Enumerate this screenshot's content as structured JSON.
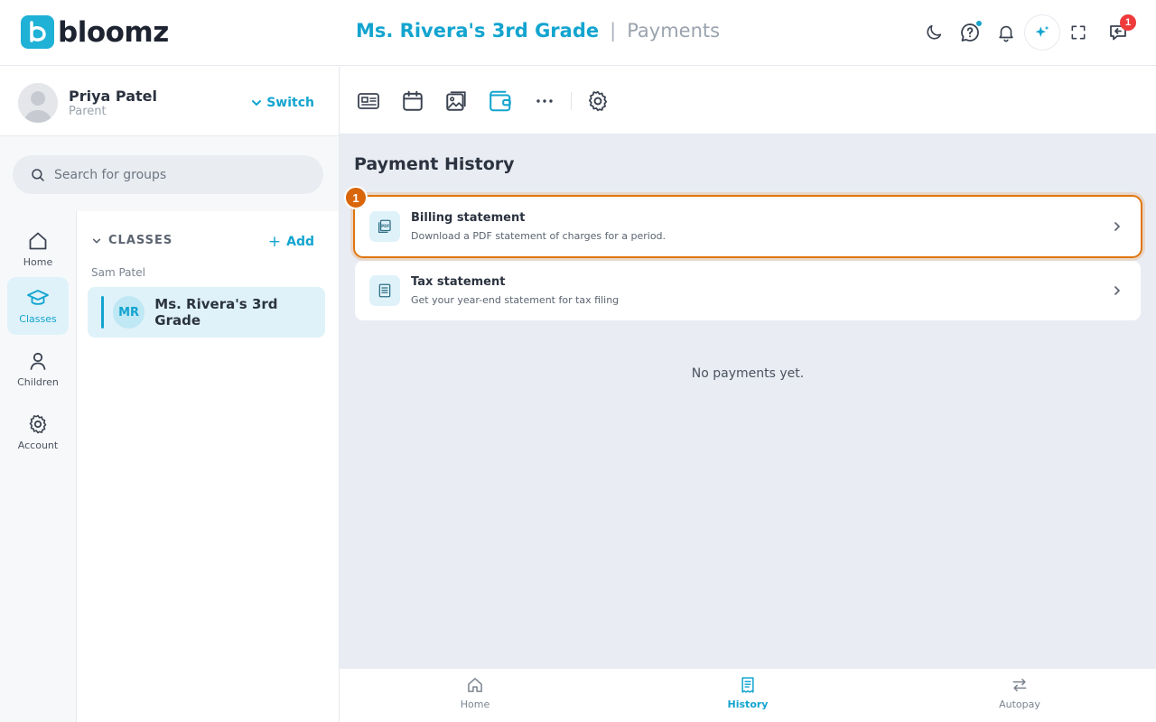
{
  "app": {
    "logo_text": "bloomz"
  },
  "header": {
    "group_title": "Ms. Rivera's 3rd Grade",
    "separator": "|",
    "section_title": "Payments",
    "inbox_badge": "1"
  },
  "user": {
    "name": "Priya Patel",
    "role": "Parent",
    "switch_label": "Switch"
  },
  "search": {
    "placeholder": "Search for groups",
    "value": ""
  },
  "rail": {
    "items": [
      {
        "label": "Home",
        "icon": "home-icon"
      },
      {
        "label": "Classes",
        "icon": "graduation-cap-icon",
        "active": true
      },
      {
        "label": "Children",
        "icon": "person-icon"
      },
      {
        "label": "Account",
        "icon": "gear-icon"
      }
    ]
  },
  "classes": {
    "heading": "CLASSES",
    "add_label": "Add",
    "child_name": "Sam Patel",
    "items": [
      {
        "initials": "MR",
        "name": "Ms. Rivera's 3rd Grade"
      }
    ]
  },
  "toolbar": {
    "icons": [
      "contact-card-icon",
      "calendar-icon",
      "photos-icon",
      "wallet-icon",
      "more-icon",
      "settings-icon"
    ],
    "active": "wallet-icon"
  },
  "payment_history": {
    "title": "Payment History",
    "rows": [
      {
        "title": "Billing statement",
        "subtitle": "Download a PDF statement of charges for a period.",
        "icon": "pdf-document-icon",
        "step": "1"
      },
      {
        "title": "Tax statement",
        "subtitle": "Get your year-end statement for tax filing",
        "icon": "receipt-list-icon"
      }
    ],
    "empty_message": "No payments yet."
  },
  "bottom_nav": {
    "items": [
      {
        "label": "Home",
        "icon": "home-icon"
      },
      {
        "label": "History",
        "icon": "receipt-icon",
        "active": true
      },
      {
        "label": "Autopay",
        "icon": "swap-arrows-icon"
      }
    ]
  },
  "colors": {
    "accent": "#12a4cf",
    "highlight": "#e0750f",
    "badge": "#ef3b3b"
  }
}
